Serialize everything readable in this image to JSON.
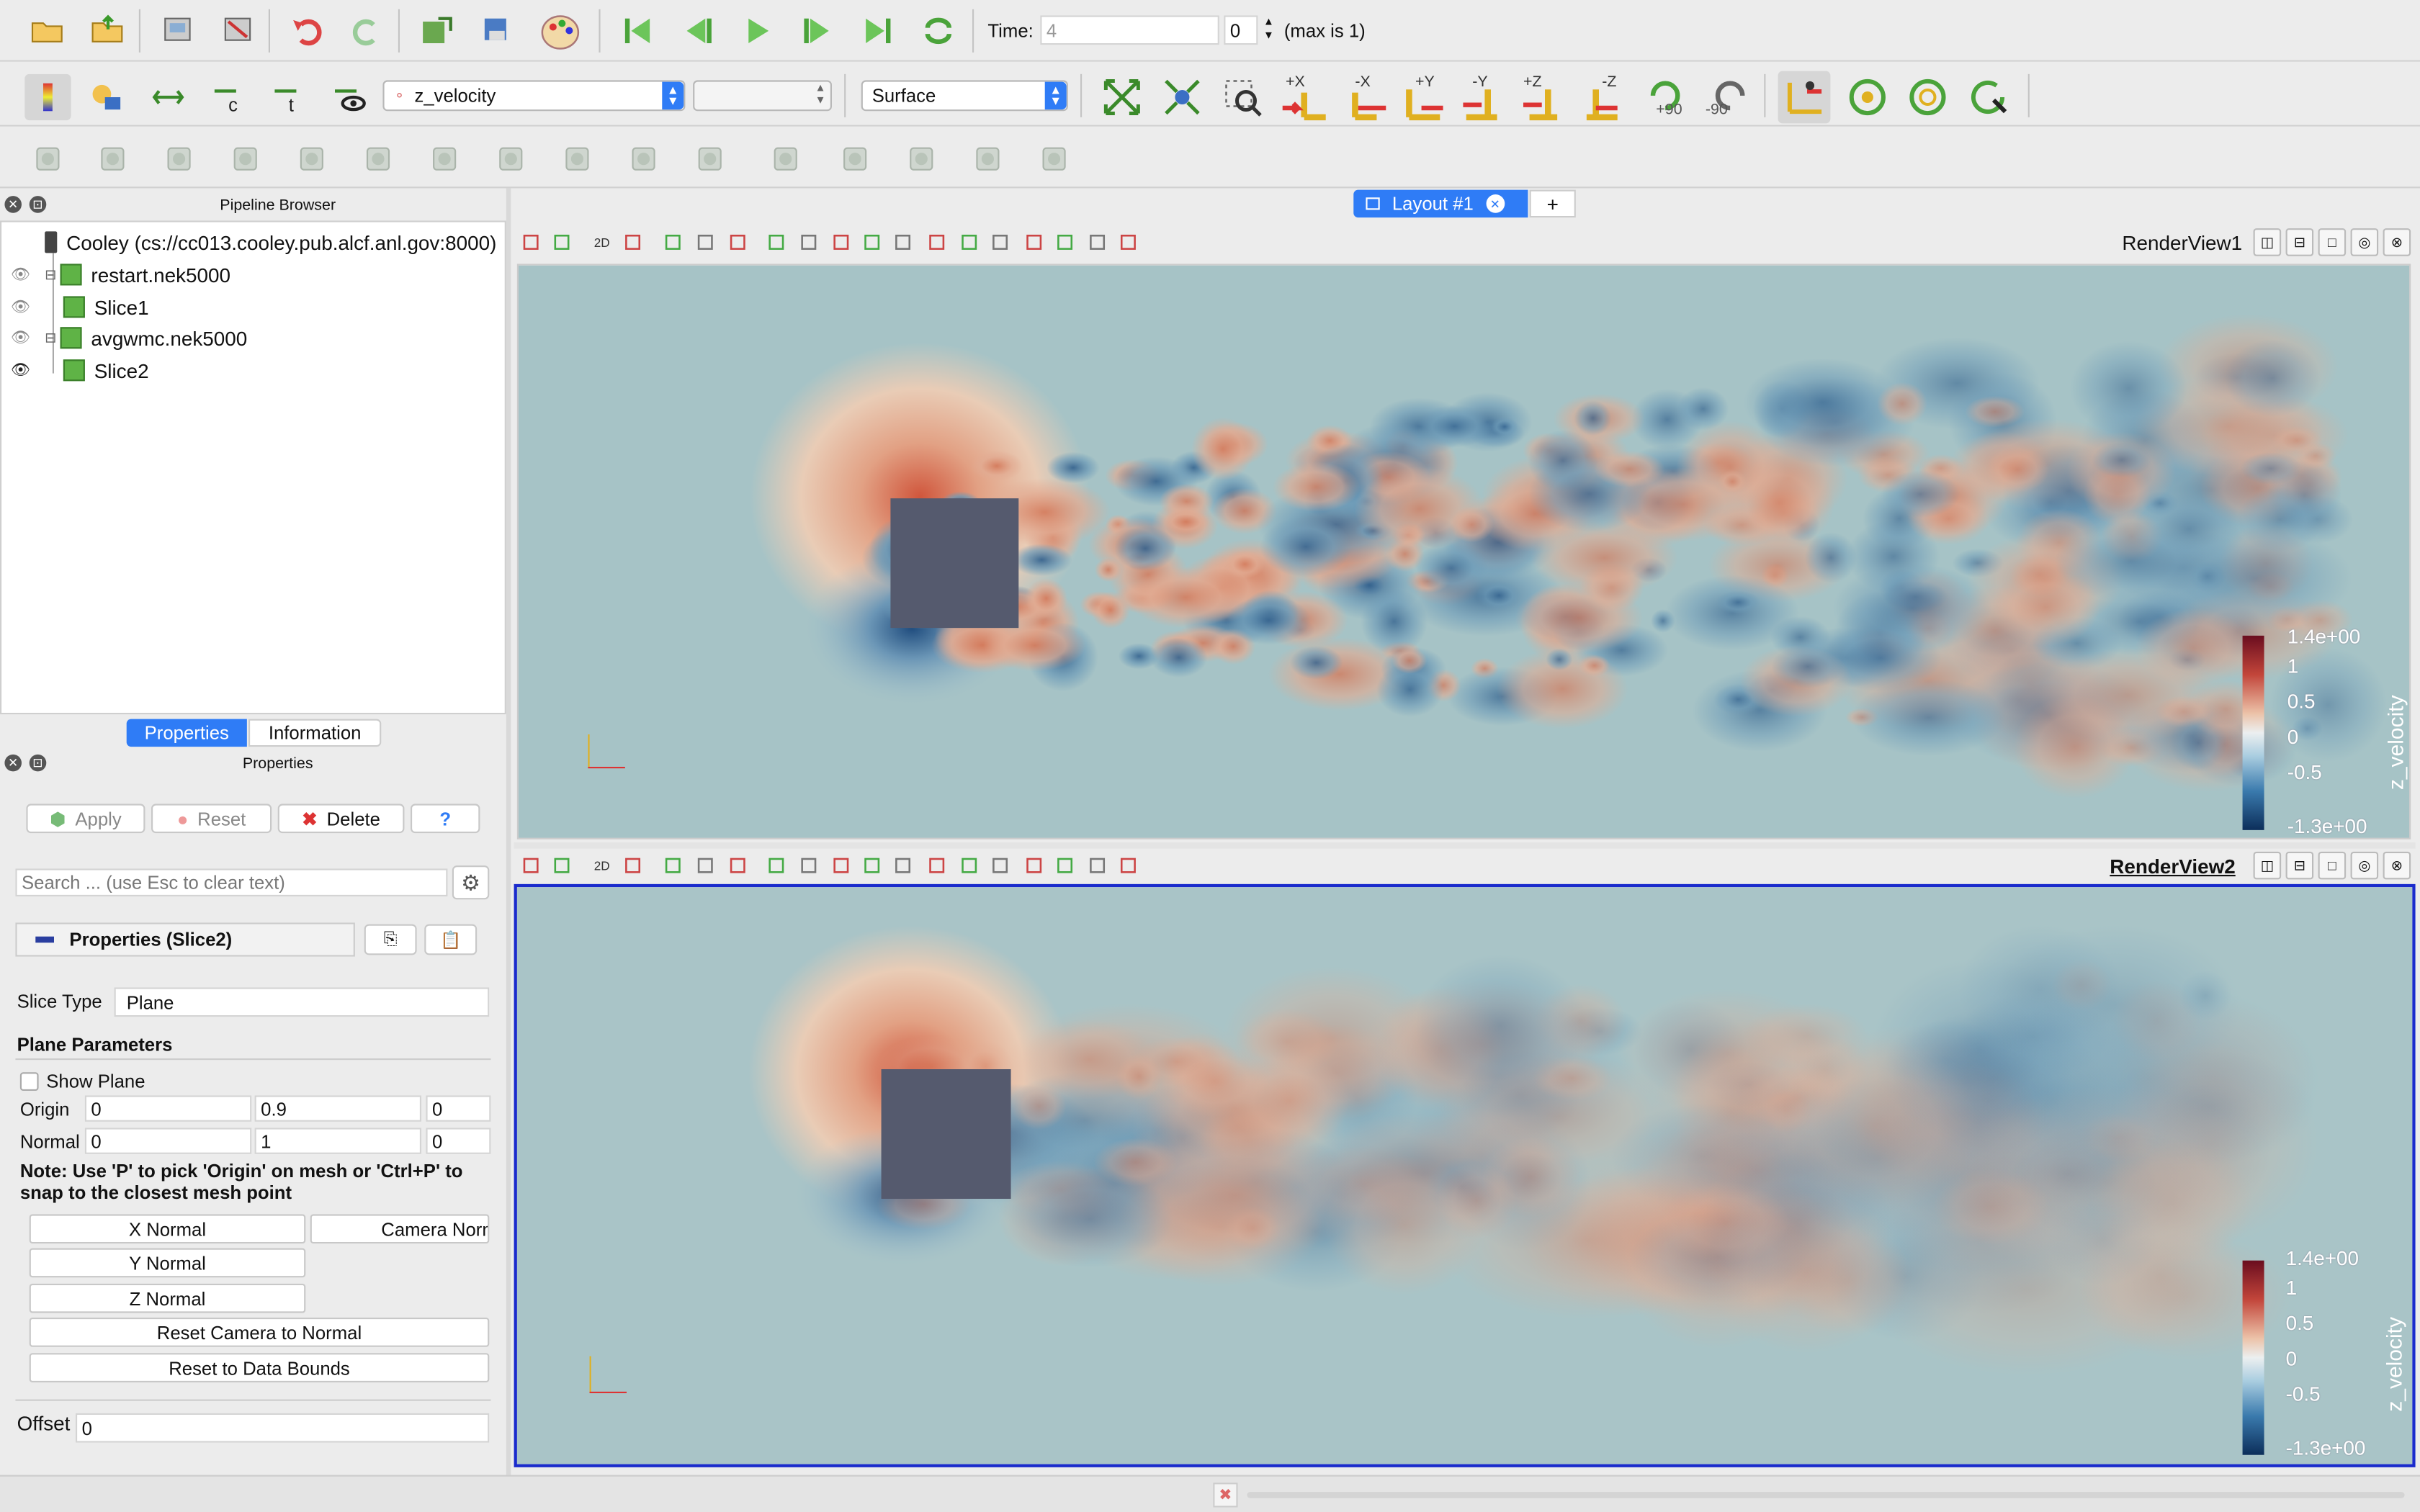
{
  "toolbar1": {
    "time_label": "Time:",
    "time_value": "4",
    "timestep_value": "0",
    "max_label": "(max is 1)"
  },
  "toolbar2": {
    "array_select": "z_velocity",
    "component_select": "",
    "representation_select": "Surface",
    "rot_plus": "+90",
    "rot_minus": "-90",
    "axes": [
      "+X",
      "-X",
      "+Y",
      "-Y",
      "+Z",
      "-Z"
    ]
  },
  "pipeline": {
    "title": "Pipeline Browser",
    "server": "Cooley (cs://cc013.cooley.pub.alcf.anl.gov:8000)",
    "items": [
      "restart.nek5000",
      "Slice1",
      "avgwmc.nek5000",
      "Slice2"
    ]
  },
  "tabs": {
    "properties": "Properties",
    "information": "Information"
  },
  "properties": {
    "title": "Properties",
    "apply": "Apply",
    "reset": "Reset",
    "delete": "Delete",
    "help": "?",
    "search_placeholder": "Search ... (use Esc to clear text)",
    "section": "Properties (Slice2)",
    "slice_type_label": "Slice Type",
    "slice_type_value": "Plane",
    "plane_params": "Plane Parameters",
    "show_plane": "Show Plane",
    "origin_label": "Origin",
    "origin": [
      "0",
      "0.9",
      "0"
    ],
    "normal_label": "Normal",
    "normal": [
      "0",
      "1",
      "0"
    ],
    "note": "Note: Use 'P' to pick 'Origin' on mesh or 'Ctrl+P' to snap to the closest mesh point",
    "x_normal": "X Normal",
    "camera_normal": "Camera Normal",
    "y_normal": "Y Normal",
    "z_normal": "Z Normal",
    "reset_camera": "Reset Camera to Normal",
    "reset_bounds": "Reset to Data Bounds",
    "offset_label": "Offset",
    "offset_value": "0"
  },
  "layout": {
    "tab": "Layout #1",
    "add": "+"
  },
  "views": [
    {
      "name": "RenderView1",
      "mode": "2D",
      "colorbar": {
        "title": "z_velocity",
        "ticks": [
          "1.4e+00",
          "1",
          "0.5",
          "0",
          "-0.5",
          "-1.3e+00"
        ],
        "range": [
          -1.3,
          1.4
        ]
      }
    },
    {
      "name": "RenderView2",
      "mode": "2D",
      "colorbar": {
        "title": "z_velocity",
        "ticks": [
          "1.4e+00",
          "1",
          "0.5",
          "0",
          "-0.5",
          "-1.3e+00"
        ],
        "range": [
          -1.3,
          1.4
        ]
      }
    }
  ],
  "colors": {
    "active_view_border": "#1a2bcc",
    "tab_blue": "#2f7cf6",
    "obstacle": "#555a6e",
    "background_field": "#a6c3c6"
  }
}
